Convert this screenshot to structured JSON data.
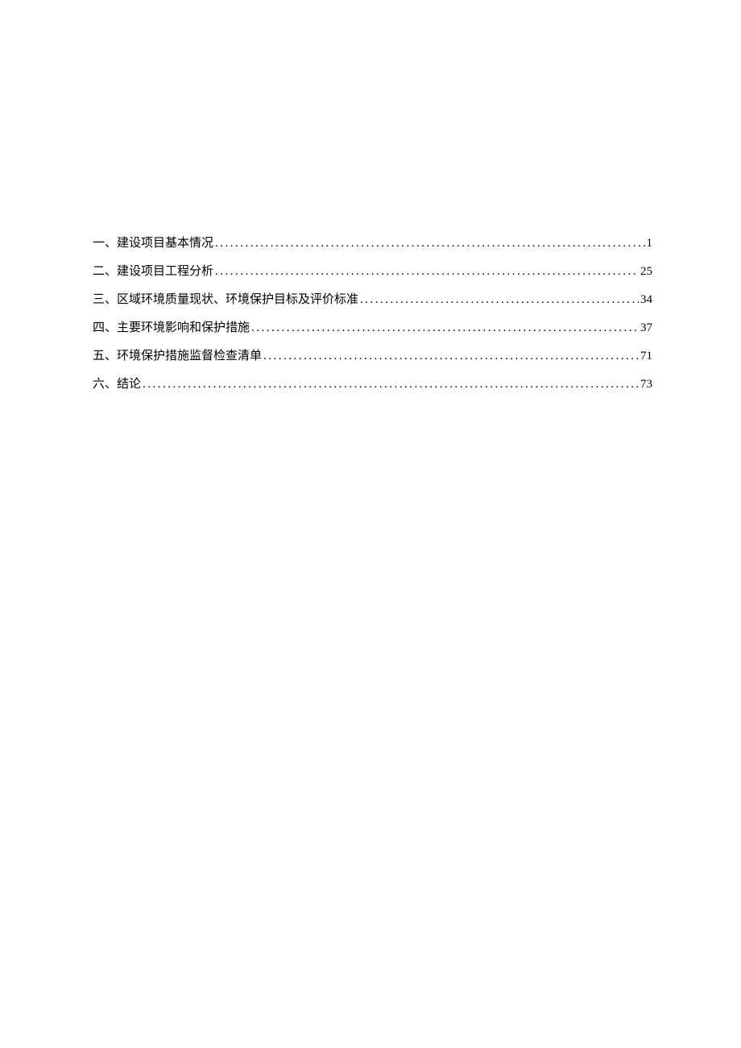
{
  "toc": {
    "entries": [
      {
        "title": "一、建设项目基本情况",
        "page": "1"
      },
      {
        "title": "二、建设项目工程分析",
        "page": "25"
      },
      {
        "title": "三、区域环境质量现状、环境保护目标及评价标准",
        "page": "34"
      },
      {
        "title": "四、主要环境影响和保护措施",
        "page": "37"
      },
      {
        "title": "五、环境保护措施监督检查清单",
        "page": "71"
      },
      {
        "title": "六、结论",
        "page": "73"
      }
    ]
  }
}
